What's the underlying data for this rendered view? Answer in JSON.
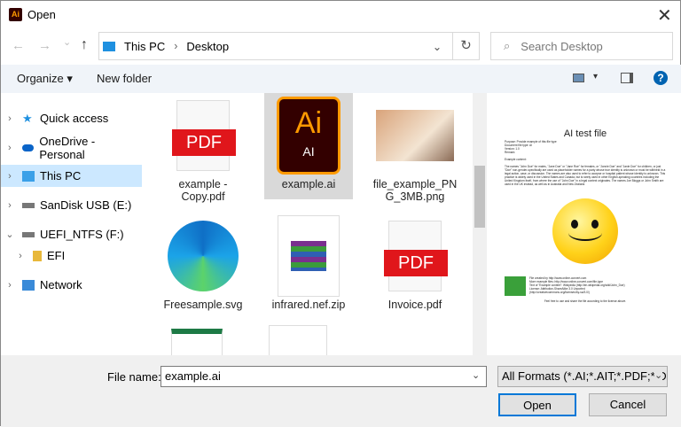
{
  "window": {
    "title": "Open",
    "app_icon_text": "Ai",
    "close": "✕"
  },
  "nav": {
    "back": "←",
    "forward": "→",
    "recent": "⌄",
    "up": "↑",
    "breadcrumb": [
      "This PC",
      "Desktop"
    ],
    "dropdown": "⌄",
    "refresh": "↻",
    "search_placeholder": "Search Desktop"
  },
  "toolbar": {
    "organize": "Organize ▾",
    "new_folder": "New folder",
    "view": "▾",
    "help": "?"
  },
  "sidebar": {
    "items": [
      {
        "label": "Quick access",
        "expander": "›"
      },
      {
        "label": "OneDrive - Personal",
        "expander": "›"
      },
      {
        "label": "This PC",
        "expander": "›"
      },
      {
        "label": "SanDisk USB (E:)",
        "expander": "›"
      },
      {
        "label": "UEFI_NTFS (F:)",
        "expander": "⌄"
      },
      {
        "label": "EFI",
        "expander": "›"
      },
      {
        "label": "Network",
        "expander": "›"
      }
    ]
  },
  "files": [
    {
      "name": "example - Copy.pdf",
      "pdf_badge": "PDF"
    },
    {
      "name": "example.ai",
      "ai_badge": "Ai",
      "ai_sub": "AI"
    },
    {
      "name": "file_example_PNG_3MB.png"
    },
    {
      "name": "Freesample.svg"
    },
    {
      "name": "infrared.nef.zip"
    },
    {
      "name": "Invoice.pdf",
      "pdf_badge": "PDF"
    }
  ],
  "preview": {
    "title": "AI test file",
    "meta": [
      "Purpose: Provide example of this file type",
      "Document file type: AI",
      "Version: 1.0",
      "Remark:"
    ],
    "section": "Example content:",
    "body": "The names \"John Doe\" for males, \"Jane Doe\" or \"Jane Roe\" for females, or \"Jonnie Doe\" and \"Janie Doe\" for children, or just \"Doe\" non-gender-specifically are used as placeholder names for a party whose true identity is unknown or must be withheld in a legal action, case, or discussion. The names are also used to refer to acorpse or hospital patient whose identity is unknown. This practice is widely used in the United States and Canada, but is rarely used in other English-speaking countries including the United Kingdom itself, from where the use of \"John Doe\" in a legal context originates. The names Joe Bloggs or John Smith are used in the UK instead, as well as in Australia and New Zealand.",
    "footer": [
      "File created by http://www.online-convert.com",
      "More example files: http://www.online-convert.com/file-type",
      "Text of \"Example content\": Wikipedia (http://en.wikipedia.org/wiki/John_Doe)",
      "License: Attribution-ShareAlike 3.0 Unported",
      "(http://creativecommons.org/licenses/by-sa/3.0/)"
    ],
    "closing": "Feel free to use and share the file according to the license above."
  },
  "bottom": {
    "file_name_label": "File name:",
    "file_name_value": "example.ai",
    "filter": "All Formats (*.AI;*.AIT;*.PDF;*.DXF",
    "open": "Open",
    "cancel": "Cancel"
  },
  "colors": {
    "accent": "#0078d7",
    "selection": "#cce8ff",
    "pdf_red": "#e0161b"
  }
}
